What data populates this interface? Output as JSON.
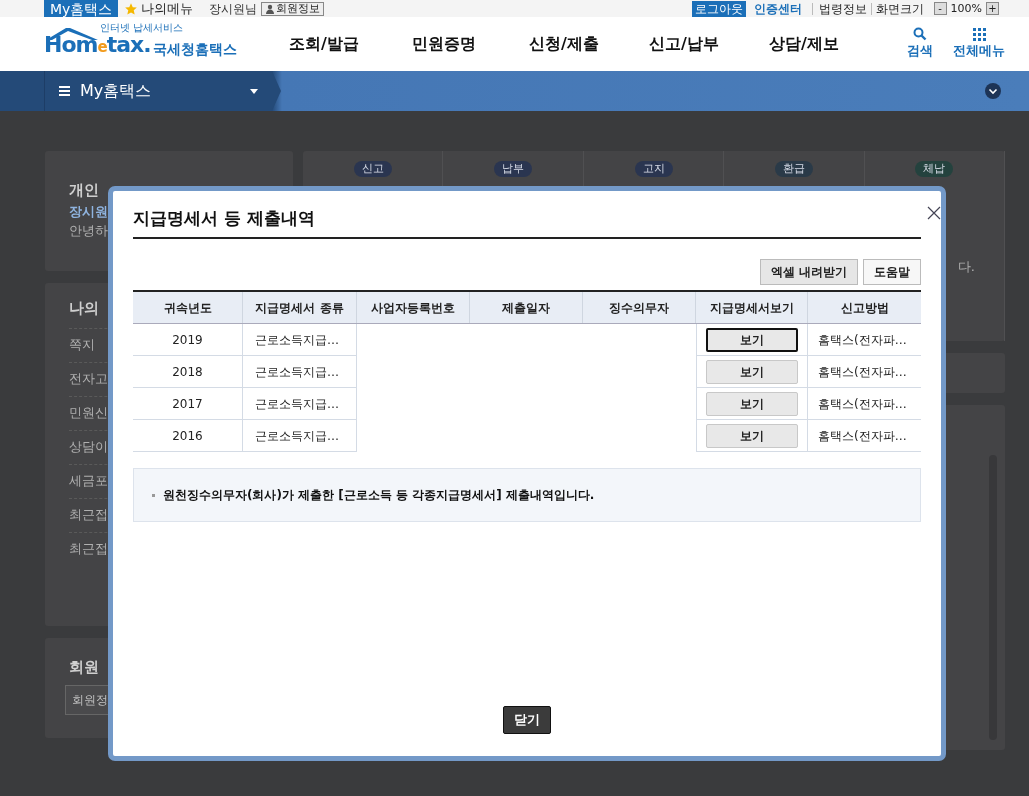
{
  "top_bar": {
    "my_tab": "My홈택스",
    "my_menu": "나의메뉴",
    "user": "장시원님",
    "member_info": "회원정보",
    "logout": "로그아웃",
    "cert_center": "인증센터",
    "law_info": "법령정보",
    "screen_size": "화면크기",
    "zoom_out": "-",
    "zoom_level": "100%",
    "zoom_in": "+"
  },
  "header": {
    "logo_tagline": "인터넷 납세서비스",
    "logo_home": "Hom",
    "logo_e": "e",
    "logo_tax": "tax.",
    "logo_name": "국세청홈택스",
    "menu": [
      "조회/발급",
      "민원증명",
      "신청/제출",
      "신고/납부",
      "상담/제보"
    ],
    "search": "검색",
    "all_menu": "전체메뉴"
  },
  "nav_bar": {
    "title": "My홈택스"
  },
  "background": {
    "profile": {
      "title": "개인",
      "name": "장시원",
      "greeting": "안녕하"
    },
    "my_panel": {
      "title": "나의",
      "items": [
        "쪽지",
        "전자고",
        "민원신",
        "상담이",
        "세금포",
        "최근접",
        "최근접"
      ]
    },
    "member_panel": {
      "title": "회원",
      "field": "회원정"
    },
    "status_pills": [
      {
        "label": "신고",
        "color": "#2a3550"
      },
      {
        "label": "납부",
        "color": "#2a3550"
      },
      {
        "label": "고지",
        "color": "#2a3550"
      },
      {
        "label": "환급",
        "color": "#2a3a48"
      },
      {
        "label": "체납",
        "color": "#24423e"
      }
    ],
    "side_note": "다."
  },
  "dialog": {
    "title": "지급명세서 등 제출내역",
    "actions": [
      "엑셀 내려받기",
      "도움말"
    ],
    "table": {
      "columns": [
        "귀속년도",
        "지급명세서 종류",
        "사업자등록번호",
        "제출일자",
        "징수의무자",
        "지급명세서보기",
        "신고방법"
      ],
      "rows": [
        {
          "year": "2019",
          "type": "근로소득지급…",
          "view": "보기",
          "focused": true,
          "method": "홈택스(전자파…"
        },
        {
          "year": "2018",
          "type": "근로소득지급…",
          "view": "보기",
          "focused": false,
          "method": "홈택스(전자파…"
        },
        {
          "year": "2017",
          "type": "근로소득지급…",
          "view": "보기",
          "focused": false,
          "method": "홈택스(전자파…"
        },
        {
          "year": "2016",
          "type": "근로소득지급…",
          "view": "보기",
          "focused": false,
          "method": "홈택스(전자파…"
        }
      ]
    },
    "note": "원천징수의무자(회사)가 제출한 [근로소득 등 각종지급명세서] 제출내역입니다.",
    "close_button": "닫기"
  }
}
